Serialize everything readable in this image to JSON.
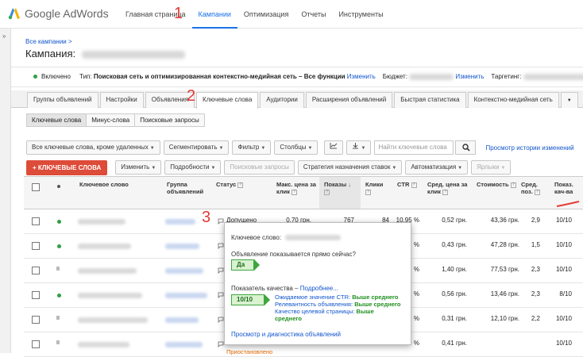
{
  "app": {
    "logo_text": "Google AdWords",
    "logo_icon": "adwords-logo-icon",
    "brand_color": "#1a73e8"
  },
  "nav": {
    "items": [
      "Главная страница",
      "Кампании",
      "Оптимизация",
      "Отчеты",
      "Инструменты"
    ],
    "active": "Кампании"
  },
  "breadcrumb": "Все кампании >",
  "campaign_title_prefix": "Кампания:",
  "status_line": {
    "status": "Включено",
    "type_label": "Тип:",
    "type_value": "Поисковая сеть и оптимизированная контекстно-медийная сеть – Все функции",
    "type_edit": "Изменить",
    "budget_label": "Бюджет:",
    "budget_edit": "Изменить",
    "targeting_label": "Таргетинг:"
  },
  "tabs": [
    "Группы объявлений",
    "Настройки",
    "Объявления",
    "Ключевые слова",
    "Аудитории",
    "Расширения объявлений",
    "Быстрая статистика",
    "Контекстно-медийная сеть"
  ],
  "active_tab": "Ключевые слова",
  "subtabs": [
    "Ключевые слова",
    "Минус-слова",
    "Поисковые запросы"
  ],
  "filters": {
    "scope": "Все ключевые слова, кроме удаленных",
    "segment": "Сегментировать",
    "filter": "Фильтр",
    "columns": "Столбцы",
    "search_placeholder": "Найти ключевые слова",
    "history_link": "Просмотр истории изменений"
  },
  "actions": {
    "add_keywords": "+ КЛЮЧЕВЫЕ СЛОВА",
    "edit": "Изменить",
    "details": "Подробности",
    "search_terms": "Поисковые запросы",
    "bid_strategy": "Стратегия назначения ставок",
    "automation": "Автоматизация",
    "labels": "Ярлыки"
  },
  "columns": {
    "keyword": "Ключевое слово",
    "adgroup": "Группа объявлений",
    "status": "Статус",
    "maxcpc": "Макс. цена за клик",
    "impressions": "Показы",
    "clicks": "Клики",
    "ctr": "CTR",
    "avgcpc": "Сред. цена за клик",
    "cost": "Стоимость",
    "avgpos": "Сред. поз.",
    "qs": "Показ. кач-ва"
  },
  "rows": [
    {
      "status": "Допущено",
      "maxcpc": "0,70 грн.",
      "impressions": "767",
      "clicks": "84",
      "ctr": "10,95 %",
      "avgcpc": "0,52 грн.",
      "cost": "43,36 грн.",
      "avgpos": "2,9",
      "qs": "10/10"
    },
    {
      "status": "",
      "maxcpc": "",
      "impressions": "",
      "clicks": "",
      "ctr": "%",
      "avgcpc": "0,43 грн.",
      "cost": "47,28 грн.",
      "avgpos": "1,5",
      "qs": "10/10"
    },
    {
      "status": "Пр",
      "maxcpc": "",
      "impressions": "",
      "clicks": "",
      "ctr": "%",
      "avgcpc": "1,40 грн.",
      "cost": "77,53 грн.",
      "avgpos": "2,3",
      "qs": "10/10"
    },
    {
      "status": "",
      "maxcpc": "",
      "impressions": "",
      "clicks": "",
      "ctr": "%",
      "avgcpc": "0,56 грн.",
      "cost": "13,46 грн.",
      "avgpos": "2,3",
      "qs": "8/10"
    },
    {
      "status": "Пр",
      "maxcpc": "",
      "impressions": "",
      "clicks": "",
      "ctr": "%",
      "avgcpc": "0,31 грн.",
      "cost": "12,10 грн.",
      "avgpos": "2,2",
      "qs": "10/10"
    },
    {
      "status": "Приостановлено",
      "maxcpc": "",
      "impressions": "",
      "clicks": "",
      "ctr": "%",
      "avgcpc": "0,41 грн.",
      "cost": "",
      "avgpos": "",
      "qs": "10/10"
    }
  ],
  "popup": {
    "keyword_label": "Ключевое слово:",
    "question": "Объявление показывается прямо сейчас?",
    "answer": "Да",
    "qs_label": "Показатель качества –",
    "qs_more": "Подробнее...",
    "qs_value": "10/10",
    "ctr_label": "Ожидаемое значение CTR:",
    "ctr_value": "Выше среднего",
    "relevance_label": "Релевантность объявления:",
    "relevance_value": "Выше среднего",
    "landing_label": "Качество целевой страницы:",
    "landing_value": "Выше",
    "landing_value2": "среднего",
    "diag_link": "Просмотр и диагностика объявлений"
  },
  "annotations": [
    "1",
    "2",
    "3"
  ],
  "colors": {
    "accent": "#1a73e8",
    "red_button": "#dd4b39",
    "annotation": "#e53935",
    "good": "#3ea63e"
  }
}
